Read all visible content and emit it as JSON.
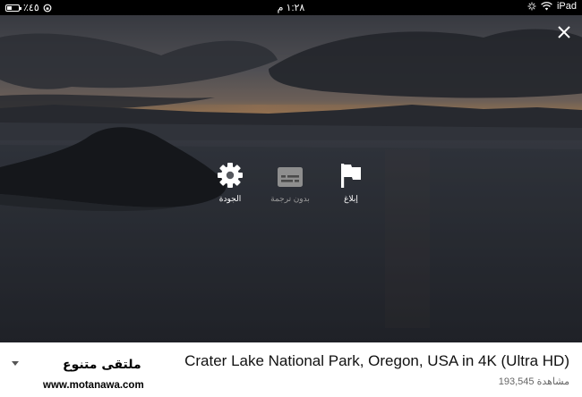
{
  "status_bar": {
    "battery_text": "٪٤٥",
    "battery_level": 0.45,
    "time": "١:٢٨ م",
    "device": "iPad"
  },
  "actions": [
    {
      "label": "إبلاغ",
      "icon": "flag-icon"
    },
    {
      "label": "بدون ترجمة",
      "icon": "captions-icon"
    },
    {
      "label": "الجودة",
      "icon": "gear-icon"
    }
  ],
  "video": {
    "title": "Crater Lake National Park, Oregon, USA in 4K (Ultra HD)",
    "views": "193,545 مشاهدة"
  },
  "watermark": {
    "name": "ملتقى متنوع",
    "url": "www.motanawa.com"
  }
}
